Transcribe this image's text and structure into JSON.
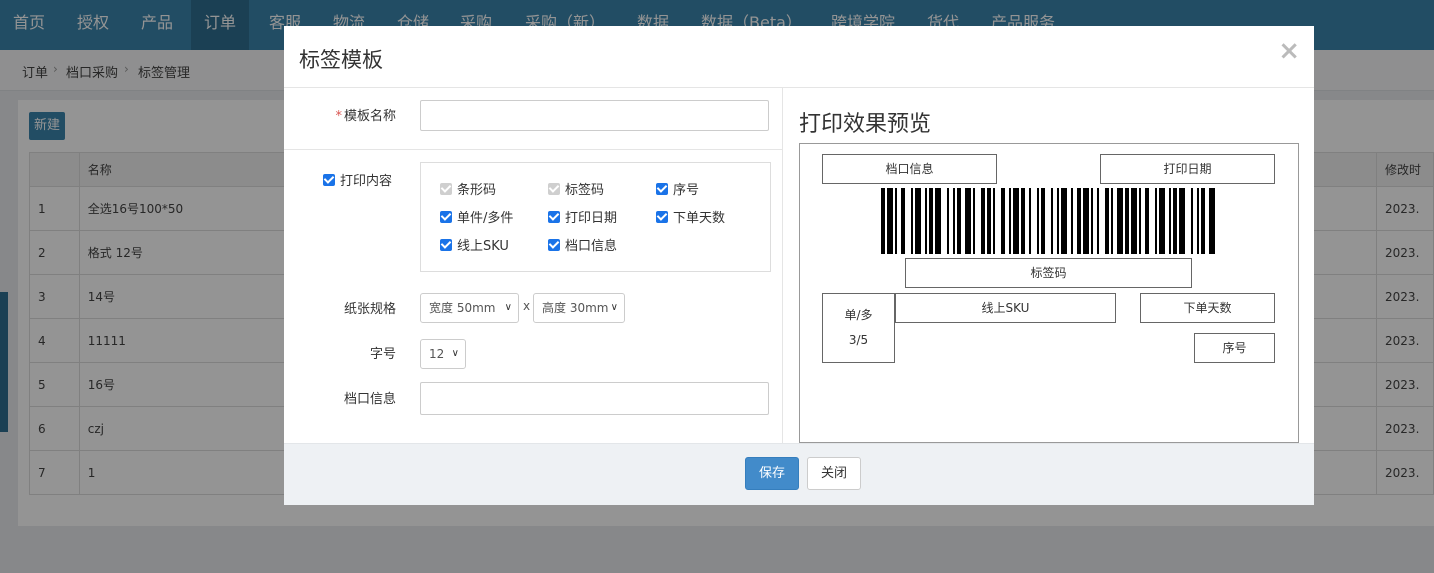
{
  "nav": {
    "items": [
      "首页",
      "授权",
      "产品",
      "订单",
      "客服",
      "物流",
      "仓储",
      "采购",
      "采购（新）",
      "数据",
      "数据（Beta）",
      "跨境学院",
      "货代",
      "产品服务"
    ],
    "active_index": 3
  },
  "breadcrumb": [
    "订单",
    "档口采购",
    "标签管理"
  ],
  "list": {
    "new_label": "新建",
    "headers": [
      "",
      "名称",
      "修改时"
    ],
    "rows": [
      {
        "no": "1",
        "name": "全选16号100*50",
        "date": "2023."
      },
      {
        "no": "2",
        "name": "格式 12号",
        "date": "2023."
      },
      {
        "no": "3",
        "name": "14号",
        "date": "2023."
      },
      {
        "no": "4",
        "name": "11111",
        "date": "2023."
      },
      {
        "no": "5",
        "name": "16号",
        "date": "2023."
      },
      {
        "no": "6",
        "name": "czj",
        "date": "2023."
      },
      {
        "no": "7",
        "name": "1",
        "date": "2023."
      }
    ]
  },
  "modal": {
    "title": "标签模板",
    "close_symbol": "×",
    "form": {
      "required_mark": "*",
      "template_name_label": "模板名称",
      "template_name_value": "",
      "print_content_label": "打印内容",
      "print_content_checked": true,
      "options": [
        {
          "label": "条形码",
          "checked": true,
          "disabled": true
        },
        {
          "label": "标签码",
          "checked": true,
          "disabled": true
        },
        {
          "label": "序号",
          "checked": true,
          "disabled": false
        },
        {
          "label": "单件/多件",
          "checked": true,
          "disabled": false
        },
        {
          "label": "打印日期",
          "checked": true,
          "disabled": false
        },
        {
          "label": "下单天数",
          "checked": true,
          "disabled": false
        },
        {
          "label": "线上SKU",
          "checked": true,
          "disabled": false
        },
        {
          "label": "档口信息",
          "checked": true,
          "disabled": false
        }
      ],
      "paper_label": "纸张规格",
      "width_value": "宽度 50mm",
      "size_separator": "x",
      "height_value": "高度 30mm",
      "font_size_label": "字号",
      "font_size_value": "12",
      "stall_info_label": "档口信息",
      "stall_info_value": ""
    },
    "preview": {
      "title": "打印效果预览",
      "stall_info": "档口信息",
      "print_date": "打印日期",
      "label_code": "标签码",
      "single_multi": "单/多",
      "count": "3/5",
      "online_sku": "线上SKU",
      "order_days": "下单天数",
      "serial_no": "序号"
    },
    "buttons": {
      "save": "保存",
      "close": "关闭"
    }
  }
}
